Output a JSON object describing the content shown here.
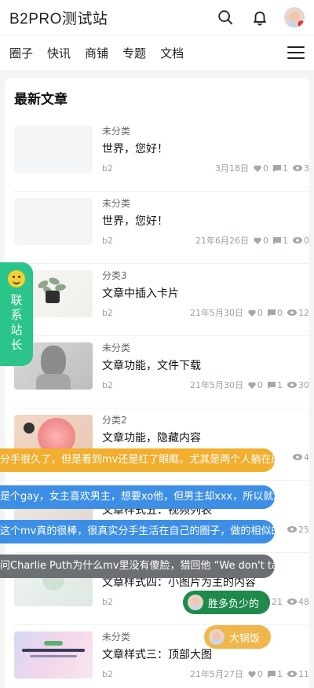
{
  "site": {
    "name": "B2PRO测试站"
  },
  "header": {
    "search_icon": "search-icon",
    "bell_icon": "bell-icon",
    "avatar": "user-avatar"
  },
  "nav": {
    "items": [
      "圈子",
      "快讯",
      "商铺",
      "专题",
      "文档"
    ],
    "menu_icon": "hamburger-menu-icon"
  },
  "section": {
    "title": "最新文章"
  },
  "posts": [
    {
      "category": "未分类",
      "title": "世界，您好！",
      "author": "b2",
      "date": "3月18日",
      "likes": "0",
      "comments": "1",
      "views": "3"
    },
    {
      "category": "未分类",
      "title": "世界，您好！",
      "author": "b2",
      "date": "21年6月26日",
      "likes": "0",
      "comments": "1",
      "views": "0"
    },
    {
      "category": "分类3",
      "title": "文章中插入卡片",
      "author": "b2",
      "date": "21年5月30日",
      "likes": "0",
      "comments": "0",
      "views": "12"
    },
    {
      "category": "未分类",
      "title": "文章功能，文件下载",
      "author": "b2",
      "date": "21年5月30日",
      "likes": "0",
      "comments": "1",
      "views": "30"
    },
    {
      "category": "分类2",
      "title": "文章功能，隐藏内容",
      "views": "4"
    },
    {
      "title": "文章样式五：视频列表",
      "views": "25"
    },
    {
      "title": "文章样式四：小图片为主的内容",
      "author": "b2",
      "date": "21",
      "views": "48"
    },
    {
      "category": "未分类",
      "title": "文章样式三：顶部大图",
      "author": "b2",
      "date": "21年5月27日",
      "likes": "0",
      "comments": "1",
      "views": "11"
    }
  ],
  "contact": {
    "label": "联系站长"
  },
  "danmaku": [
    "分手很久了，但是看到mv还是红了眼眶。尤其是两个人躺在床",
    "是个gay，女主喜欢男主，想要xo他，但男主却xxx，所以就。",
    "这个mv真的很棒，很真实分手生活在自己的圈子，做的相似的",
    "问Charlie Puth为什么mv里没有傻脸，猎回他 “We don't talk"
  ],
  "pills": [
    {
      "label": "胜多负少的"
    },
    {
      "label": "大锅饭"
    }
  ],
  "colors": {
    "accent_green": "#2bc48a",
    "danmaku_yellow": "#f2ae2f",
    "danmaku_blue": "#3d8fe6",
    "danmaku_gray": "#6c7075",
    "pill_green": "#1f8a4c",
    "pill_yellow": "#efb74b"
  }
}
